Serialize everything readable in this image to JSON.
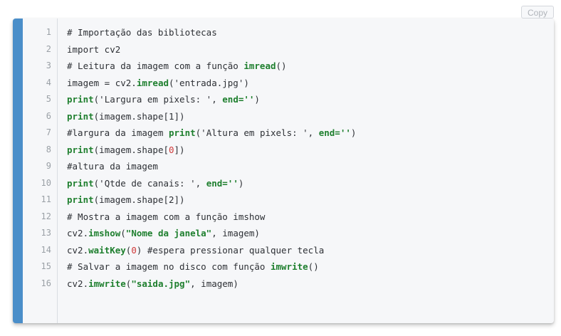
{
  "copy_button": {
    "label": "Copy"
  },
  "colors": {
    "accent_bar": "#4a8ec9",
    "background": "#f6f7f9",
    "keyword": "#1e7f2e",
    "number": "#d03a3a"
  },
  "code": {
    "language": "python",
    "lines": [
      {
        "num": "1",
        "tokens": [
          {
            "t": "# Importação das bibliotecas",
            "k": "cm"
          }
        ]
      },
      {
        "num": "2",
        "tokens": [
          {
            "t": "import cv2",
            "k": "plain"
          }
        ]
      },
      {
        "num": "3",
        "tokens": [
          {
            "t": "# Leitura da imagem com a função ",
            "k": "cm"
          },
          {
            "t": "imread",
            "k": "kw"
          },
          {
            "t": "()",
            "k": "plain"
          }
        ]
      },
      {
        "num": "4",
        "tokens": [
          {
            "t": "imagem = cv2.",
            "k": "plain"
          },
          {
            "t": "imread",
            "k": "kw"
          },
          {
            "t": "('entrada.jpg')",
            "k": "plain"
          }
        ]
      },
      {
        "num": "5",
        "tokens": [
          {
            "t": "print",
            "k": "kw"
          },
          {
            "t": "('Largura em pixels: ', ",
            "k": "plain"
          },
          {
            "t": "end=''",
            "k": "str"
          },
          {
            "t": ")",
            "k": "plain"
          }
        ]
      },
      {
        "num": "6",
        "tokens": [
          {
            "t": "print",
            "k": "kw"
          },
          {
            "t": "(imagem.shape[1])",
            "k": "plain"
          }
        ]
      },
      {
        "num": "7",
        "tokens": [
          {
            "t": "#largura da imagem ",
            "k": "cm"
          },
          {
            "t": "print",
            "k": "kw"
          },
          {
            "t": "('Altura em pixels: ', ",
            "k": "plain"
          },
          {
            "t": "end=''",
            "k": "str"
          },
          {
            "t": ")",
            "k": "plain"
          }
        ]
      },
      {
        "num": "8",
        "tokens": [
          {
            "t": "print",
            "k": "kw"
          },
          {
            "t": "(imagem.shape[",
            "k": "plain"
          },
          {
            "t": "0",
            "k": "num"
          },
          {
            "t": "])",
            "k": "plain"
          }
        ]
      },
      {
        "num": "9",
        "tokens": [
          {
            "t": "#altura da imagem",
            "k": "cm"
          }
        ]
      },
      {
        "num": "10",
        "tokens": [
          {
            "t": "print",
            "k": "kw"
          },
          {
            "t": "('Qtde de canais: ', ",
            "k": "plain"
          },
          {
            "t": "end=''",
            "k": "str"
          },
          {
            "t": ")",
            "k": "plain"
          }
        ]
      },
      {
        "num": "11",
        "tokens": [
          {
            "t": "print",
            "k": "kw"
          },
          {
            "t": "(imagem.shape[2])",
            "k": "plain"
          }
        ]
      },
      {
        "num": "12",
        "tokens": [
          {
            "t": "# Mostra a imagem com a função imshow",
            "k": "cm"
          }
        ]
      },
      {
        "num": "13",
        "tokens": [
          {
            "t": "cv2.",
            "k": "plain"
          },
          {
            "t": "imshow",
            "k": "kw"
          },
          {
            "t": "(",
            "k": "plain"
          },
          {
            "t": "\"Nome da janela\"",
            "k": "str"
          },
          {
            "t": ", imagem)",
            "k": "plain"
          }
        ]
      },
      {
        "num": "14",
        "tokens": [
          {
            "t": "cv2.",
            "k": "plain"
          },
          {
            "t": "waitKey",
            "k": "kw"
          },
          {
            "t": "(",
            "k": "plain"
          },
          {
            "t": "0",
            "k": "num"
          },
          {
            "t": ") #espera pressionar qualquer tecla",
            "k": "plain"
          }
        ]
      },
      {
        "num": "15",
        "tokens": [
          {
            "t": "# Salvar a imagem no disco com função ",
            "k": "cm"
          },
          {
            "t": "imwrite",
            "k": "kw"
          },
          {
            "t": "()",
            "k": "plain"
          }
        ]
      },
      {
        "num": "16",
        "tokens": [
          {
            "t": "cv2.",
            "k": "plain"
          },
          {
            "t": "imwrite",
            "k": "kw"
          },
          {
            "t": "(",
            "k": "plain"
          },
          {
            "t": "\"saida.jpg\"",
            "k": "str"
          },
          {
            "t": ", imagem)",
            "k": "plain"
          }
        ]
      }
    ]
  }
}
